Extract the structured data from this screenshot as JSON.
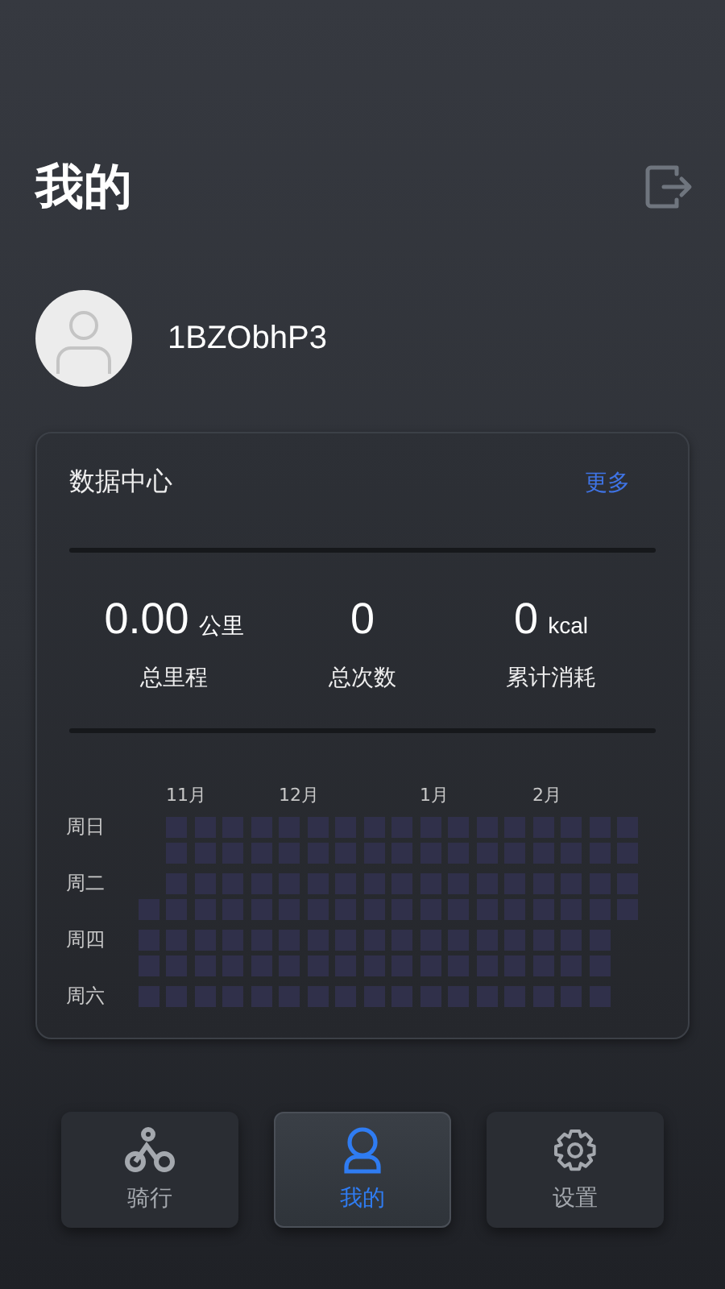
{
  "header": {
    "title": "我的"
  },
  "profile": {
    "username": "1BZObhP3"
  },
  "data_center": {
    "title": "数据中心",
    "more_link": "更多",
    "stats": [
      {
        "value": "0.00",
        "unit": "公里",
        "label": "总里程"
      },
      {
        "value": "0",
        "label": "总次数"
      },
      {
        "value": "0",
        "unit": "kcal",
        "label": "累计消耗"
      }
    ],
    "heatmap": {
      "months": [
        "11月",
        "12月",
        "1月",
        "2月"
      ],
      "weekdays": [
        "周日",
        "周二",
        "周四",
        "周六"
      ]
    }
  },
  "tabs": [
    {
      "label": "骑行",
      "kind": "ride",
      "selected": false
    },
    {
      "label": "我的",
      "kind": "profile",
      "selected": true
    },
    {
      "label": "设置",
      "kind": "settings",
      "selected": false
    }
  ]
}
